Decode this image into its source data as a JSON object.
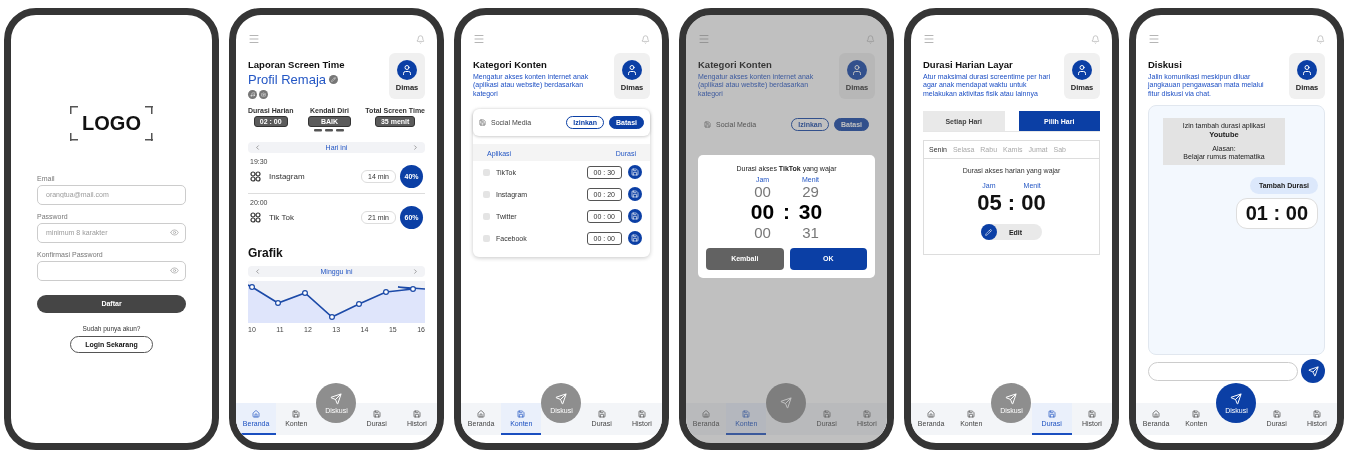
{
  "screens": [
    {
      "kind": "login",
      "logo": "LOGO",
      "fields": [
        {
          "label": "Email",
          "placeholder": "orangtua@mail.com",
          "secret": false
        },
        {
          "label": "Password",
          "placeholder": "minimum 8 karakter",
          "secret": true
        },
        {
          "label": "Konfirmasi Password",
          "secret": true
        }
      ],
      "submit": "Daftar",
      "prompt": "Sudah punya akun?",
      "login": "Login Sekarang"
    },
    {
      "kind": "report",
      "title": "Laporan Screen Time",
      "subtitle": "Profil Remaja",
      "profile": "Dimas",
      "stats": [
        {
          "kind": "box",
          "label": "Durasi Harian",
          "value": "02 : 00"
        },
        {
          "kind": "badge",
          "label": "Kendali Diri",
          "value": "BAIK"
        },
        {
          "kind": "box",
          "label": "Total Screen Time",
          "value": "35 menit"
        }
      ],
      "day_nav": "Hari ini",
      "apps": [
        {
          "time": "19:30",
          "name": "Instagram",
          "duration": "14 min",
          "share": "40%"
        },
        {
          "time": "20:00",
          "name": "Tik Tok",
          "duration": "21 min",
          "share": "60%"
        }
      ],
      "chart": {
        "title": "Grafik",
        "range": "Minggu ini",
        "days": [
          "10",
          "11",
          "12",
          "13",
          "14",
          "15",
          "16"
        ]
      },
      "nav": [
        {
          "label": "Beranda",
          "selected": true
        },
        {
          "label": "Konten",
          "selected": false
        },
        {
          "label": "Durasi",
          "selected": false
        },
        {
          "label": "Histori",
          "selected": false
        }
      ],
      "fab": {
        "label": "Diskusi",
        "selected": false
      }
    },
    {
      "kind": "content",
      "title": "Kategori Konten",
      "description": "Mengatur akses konten internet anak (aplikasi atau website) berdasarkan kategori",
      "profile": "Dimas",
      "category": {
        "name": "Social Media",
        "options": [
          {
            "label": "Izinkan",
            "selected": false
          },
          {
            "label": "Batasi",
            "selected": true
          }
        ]
      },
      "columns": [
        "Aplikasi",
        "Durasi"
      ],
      "rows": [
        {
          "name": "TikTok",
          "duration": "00 : 30"
        },
        {
          "name": "Instagram",
          "duration": "00 : 20"
        },
        {
          "name": "Twitter",
          "duration": "00 : 00"
        },
        {
          "name": "Facebook",
          "duration": "00 : 00"
        }
      ],
      "nav": [
        {
          "label": "Beranda",
          "selected": false
        },
        {
          "label": "Konten",
          "selected": true
        },
        {
          "label": "Durasi",
          "selected": false
        },
        {
          "label": "Histori",
          "selected": false
        }
      ],
      "fab": {
        "label": "Diskusi",
        "selected": false
      }
    },
    {
      "kind": "picker",
      "title": "Kategori Konten",
      "description": "Mengatur akses konten internet anak (aplikasi atau website) berdasarkan kategori",
      "profile": "Dimas",
      "category": {
        "name": "Social Media",
        "options": [
          {
            "label": "Izinkan",
            "selected": false
          },
          {
            "label": "Batasi",
            "selected": true
          }
        ]
      },
      "modal": {
        "title": "Durasi akses **TikTok** yang wajar",
        "units": [
          "Jam",
          "Menit"
        ],
        "separator": ":",
        "rows": [
          {
            "hours": "00",
            "minutes": "29",
            "selected": false
          },
          {
            "hours": "00",
            "minutes": "30",
            "selected": true
          },
          {
            "hours": "00",
            "minutes": "31",
            "selected": false
          }
        ],
        "cancel": "Kembali",
        "confirm": "OK"
      },
      "nav": [
        {
          "label": "Beranda",
          "selected": false
        },
        {
          "label": "Konten",
          "selected": true
        },
        {
          "label": "Durasi",
          "selected": false
        },
        {
          "label": "Histori",
          "selected": false
        }
      ],
      "fab": {
        "selected": false
      }
    },
    {
      "kind": "duration",
      "title": "Durasi Harian Layar",
      "description": "Atur maksimal durasi screentime per hari agar anak mendapat waktu untuk melakukan aktivitas fisik atau lainnya",
      "profile": "Dimas",
      "modes": [
        {
          "label": "Setiap Hari",
          "selected": false
        },
        {
          "label": "Pilih Hari",
          "selected": true
        }
      ],
      "days": [
        {
          "label": "Senin",
          "selected": true
        },
        {
          "label": "Selasa",
          "selected": false
        },
        {
          "label": "Rabu",
          "selected": false
        },
        {
          "label": "Kamis",
          "selected": false
        },
        {
          "label": "Jumat",
          "selected": false
        },
        {
          "label": "Sab",
          "selected": false
        }
      ],
      "caption": "Durasi akses harian yang wajar",
      "units": [
        "Jam",
        "Menit"
      ],
      "value": "05 : 00",
      "edit": "Edit",
      "nav": [
        {
          "label": "Beranda",
          "selected": false
        },
        {
          "label": "Konten",
          "selected": false
        },
        {
          "label": "Durasi",
          "selected": true
        },
        {
          "label": "Histori",
          "selected": false
        }
      ],
      "fab": {
        "label": "Diskusi",
        "selected": false
      }
    },
    {
      "kind": "chat",
      "title": "Diskusi",
      "description": "Jalin komunikasi meskipun diluar jangkauan pengawasan mata melalui fitur diskusi via chat.",
      "profile": "Dimas",
      "request": {
        "title": "Izin tambah durasi aplikasi",
        "app": "Youtube",
        "reason_label": "Alasan:",
        "reason": "Belajar rumus matematika"
      },
      "reply": "Tambah Durasi",
      "granted": "01 : 00",
      "nav": [
        {
          "label": "Beranda",
          "selected": false
        },
        {
          "label": "Konten",
          "selected": false
        },
        {
          "label": "Durasi",
          "selected": false
        },
        {
          "label": "Histori",
          "selected": false
        }
      ],
      "fab": {
        "label": "Diskusi",
        "selected": true
      }
    }
  ]
}
